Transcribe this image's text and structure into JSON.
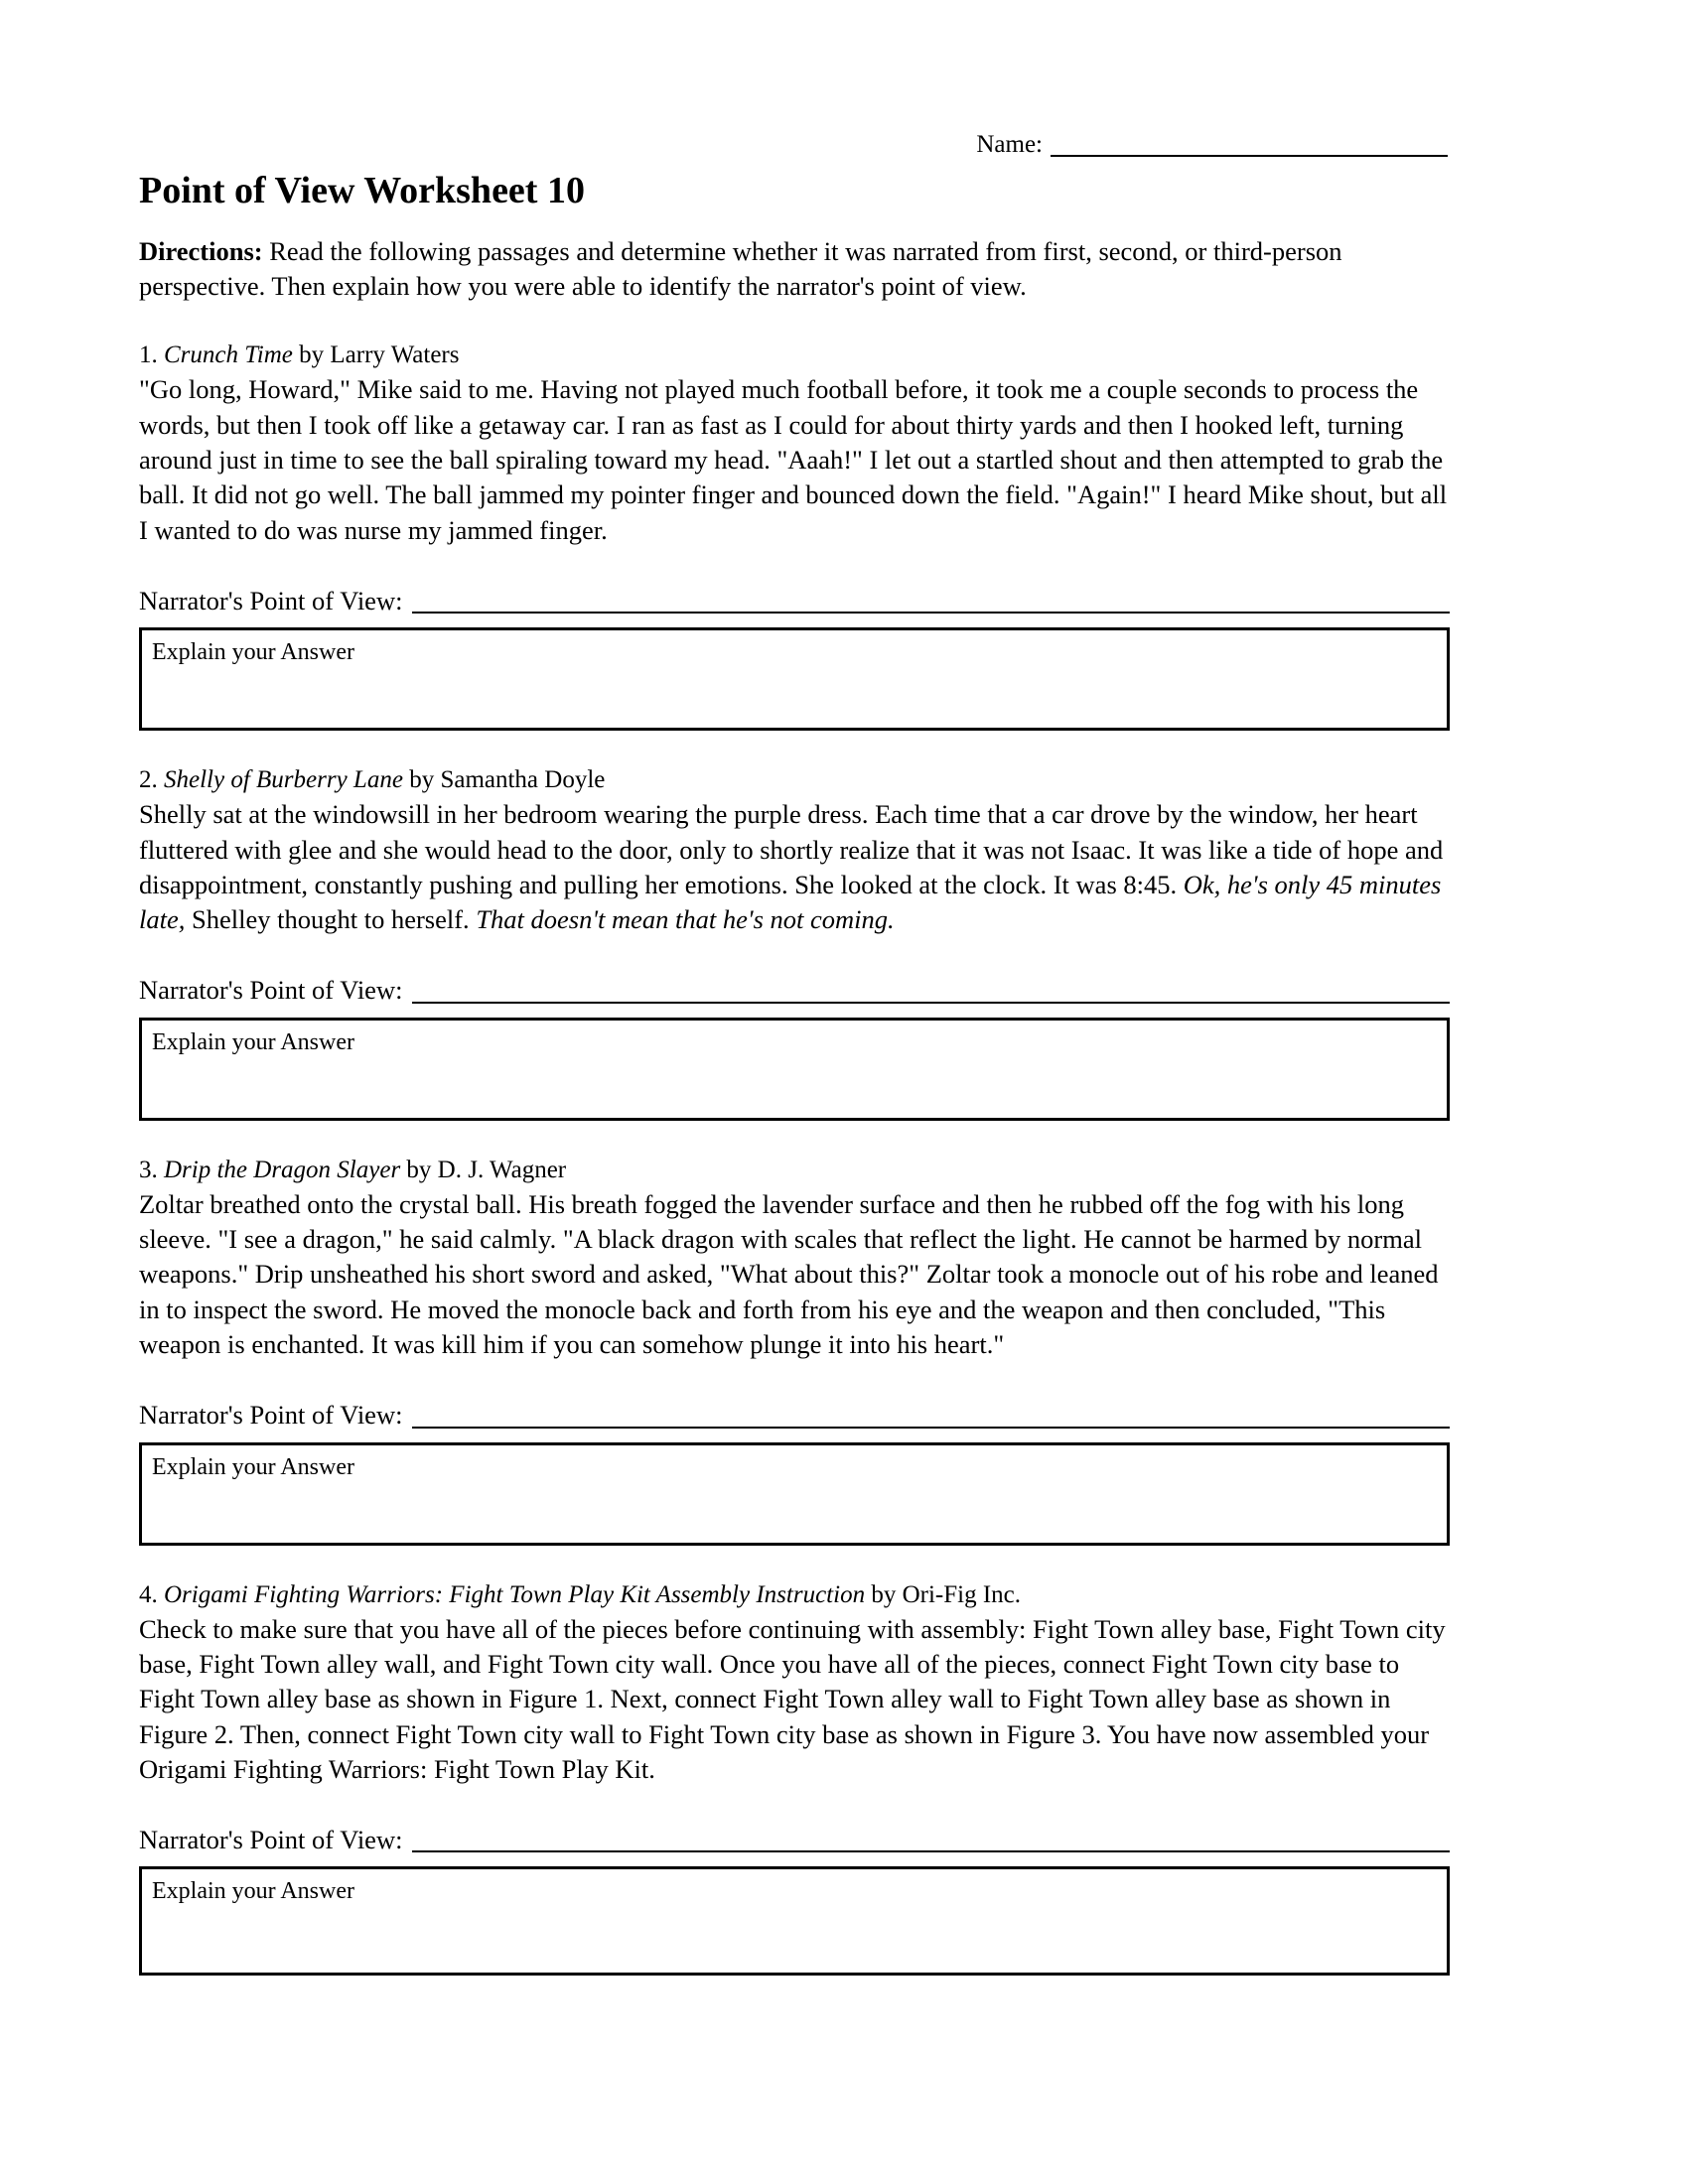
{
  "header": {
    "name_label": "Name:",
    "title": "Point of View Worksheet 10"
  },
  "directions": {
    "label": "Directions:",
    "text": " Read the following passages and determine whether it was narrated from first, second, or third-person perspective. Then explain how you were able to identify the narrator's point of view."
  },
  "labels": {
    "pov": "Narrator's Point of View:",
    "explain": "Explain your Answer"
  },
  "passages": [
    {
      "number": "1.",
      "title": "Crunch Time",
      "byline": " by Larry Waters",
      "body": "\"Go long, Howard,\" Mike said to me. Having not played much football before, it took me a couple seconds to process the words, but then I took off like a getaway car. I ran as fast as I could for about thirty yards and then I hooked left, turning around just in time to see the ball spiraling toward my head. \"Aaah!\" I let out a startled shout and then attempted to grab the ball. It did not go well. The ball jammed my pointer finger and bounced down the field. \"Again!\" I heard Mike shout, but all I wanted to do was nurse my jammed finger."
    },
    {
      "number": "2.",
      "title": "Shelly of Burberry Lane",
      "byline": " by Samantha Doyle",
      "body_part1": "Shelly sat at the windowsill in her bedroom wearing the purple dress. Each time that a car drove by the window, her heart fluttered with glee and she would head to the door, only to shortly realize that it was not Isaac. It was like a tide of hope and disappointment, constantly pushing and pulling her emotions. She looked at the clock. It was 8:45. ",
      "body_italic1": "Ok, he's only 45 minutes late,",
      "body_part2": " Shelley thought to herself. ",
      "body_italic2": "That doesn't mean that he's not coming."
    },
    {
      "number": "3.",
      "title": "Drip the Dragon Slayer",
      "byline": " by D. J. Wagner",
      "body": "Zoltar breathed onto the crystal ball. His breath fogged the lavender surface and then he rubbed off the fog with his long sleeve. \"I see a dragon,\" he said calmly. \"A black dragon with scales that reflect the light. He cannot be harmed by normal weapons.\" Drip unsheathed his short sword and asked, \"What about this?\" Zoltar took a monocle out of his robe and leaned in to inspect the sword. He moved the monocle back and forth from his eye and the weapon and then concluded, \"This weapon is enchanted. It was kill him if you can somehow plunge it into his heart.\""
    },
    {
      "number": "4.",
      "title": "Origami Fighting Warriors: Fight Town Play Kit Assembly Instruction",
      "byline": " by Ori-Fig Inc.",
      "body": "Check to make sure that you have all of the pieces before continuing with assembly: Fight Town alley base, Fight Town city base, Fight Town alley wall, and Fight Town city wall. Once you have all of the pieces, connect Fight Town city base to Fight Town alley base as shown in Figure 1. Next, connect Fight Town alley wall to Fight Town alley base as shown in Figure 2. Then, connect Fight Town city wall to Fight Town city base as shown in Figure 3. You have now assembled your Origami Fighting Warriors: Fight Town Play Kit."
    }
  ]
}
